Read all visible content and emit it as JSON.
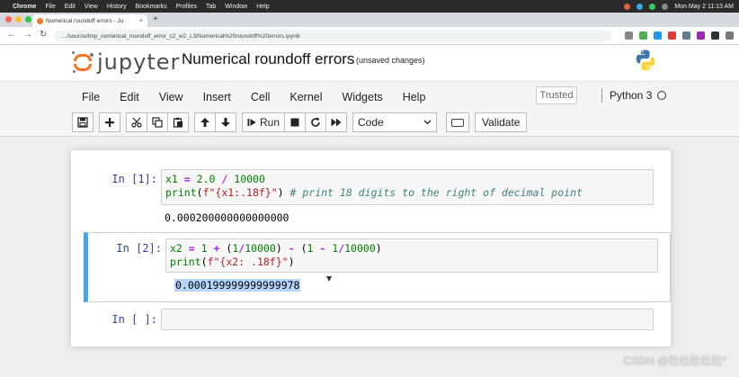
{
  "menubar": {
    "app": "Chrome",
    "items": [
      "File",
      "Edit",
      "View",
      "History",
      "Bookmarks",
      "Profiles",
      "Tab",
      "Window",
      "Help"
    ],
    "clock": "Mon May 2  11:13 AM"
  },
  "browser": {
    "tab_title": "Numerical roundoff errors - Ju",
    "url": "…/source/tmp_numerical_roundoff_error_c2_w2_L3/Numerical%20roundoff%20errors.ipynb"
  },
  "jupyter": {
    "logo_text": "jupyter",
    "notebook_title": "Numerical roundoff errors",
    "save_status": "(unsaved changes)",
    "menu": [
      "File",
      "Edit",
      "View",
      "Insert",
      "Cell",
      "Kernel",
      "Widgets",
      "Help"
    ],
    "trusted": "Trusted",
    "kernel_name": "Python 3",
    "toolbar": {
      "run_label": "Run",
      "cell_type": "Code",
      "validate_label": "Validate"
    }
  },
  "cells": [
    {
      "prompt": "In [1]:",
      "code_lines": [
        "x1 = 2.0 / 10000",
        "print(f\"{x1:.18f}\") # print 18 digits to the right of decimal point"
      ],
      "output": "0.000200000000000000"
    },
    {
      "prompt": "In [2]:",
      "code_lines": [
        "x2 = 1 + (1/10000) - (1 - 1/10000)",
        "print(f\"{x2: .18f}\")"
      ],
      "output": "0.000199999999999978"
    },
    {
      "prompt": "In [ ]:",
      "code_lines": [
        ""
      ],
      "output": ""
    }
  ],
  "watermark": "CSDN @杜杜杜杜杜*",
  "icons": [
    "save-icon",
    "plus-icon",
    "scissors-icon",
    "copy-icon",
    "paste-icon",
    "arrow-up-icon",
    "arrow-down-icon",
    "run-icon",
    "stop-icon",
    "restart-icon",
    "fast-forward-icon",
    "keyboard-icon",
    "python-logo-icon"
  ],
  "colors": {
    "jupyter_orange": "#f37726",
    "selected_cell_border": "#42a5f5",
    "prompt_blue": "#303f9f",
    "output_highlight": "#b5d5fb"
  }
}
